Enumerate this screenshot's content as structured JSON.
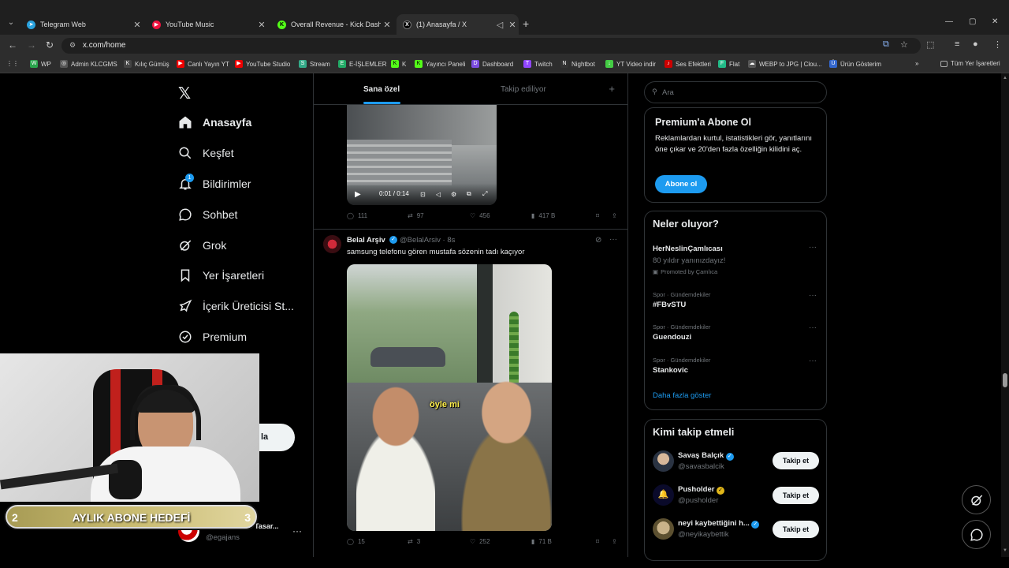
{
  "browser": {
    "tabs": [
      {
        "title": "Telegram Web",
        "color": "#2aa3df"
      },
      {
        "title": "YouTube Music",
        "color": "#f0113d"
      },
      {
        "title": "Overall Revenue - Kick Dashbo",
        "color": "#53fc18"
      },
      {
        "title": "(1) Anasayfa / X",
        "color": "#ffffff"
      }
    ],
    "url": "x.com/home",
    "bookmarks": [
      "WP",
      "Admin KLCGMS",
      "Kılıç Gümüş",
      "Canlı Yayın YT",
      "YouTube Studio",
      "Stream",
      "E-İŞLEMLER",
      "K",
      "Yayıncı Paneli",
      "Dashboard",
      "Twitch",
      "Nightbot",
      "YT Video indir",
      "Ses Efektleri",
      "Flat",
      "WEBP to JPG | Clou...",
      "Ürün Gösterim"
    ],
    "all_bookmarks": "Tüm Yer İşaretleri"
  },
  "sidebar": {
    "items": [
      {
        "label": "Anasayfa",
        "icon": "home-icon"
      },
      {
        "label": "Keşfet",
        "icon": "search-icon"
      },
      {
        "label": "Bildirimler",
        "icon": "bell-icon",
        "badge": "1"
      },
      {
        "label": "Sohbet",
        "icon": "chat-icon"
      },
      {
        "label": "Grok",
        "icon": "grok-icon"
      },
      {
        "label": "Yer İşaretleri",
        "icon": "bookmark-icon"
      },
      {
        "label": "İçerik Üreticisi St...",
        "icon": "rocket-icon"
      },
      {
        "label": "Premium",
        "icon": "verified-icon"
      }
    ],
    "post_button_partial": "la",
    "account": {
      "name": "Eg Ajans Web Tasar...",
      "handle": "@egajans"
    }
  },
  "feed": {
    "tabs": [
      "Sana özel",
      "Takip ediliyor"
    ],
    "post1": {
      "video_time": "0:01 / 0:14",
      "replies": "111",
      "reposts": "97",
      "likes": "456",
      "views": "417 B"
    },
    "post2": {
      "name": "Belal Arşiv",
      "handle": "@BelalArsiv · 8s",
      "text": "samsung telefonu gören mustafa sözenin tadı kaçıyor",
      "subtitle": "öyle mi",
      "replies": "15",
      "reposts": "3",
      "likes": "252",
      "views": "71 B"
    }
  },
  "right": {
    "search_placeholder": "Ara",
    "premium": {
      "title": "Premium'a Abone Ol",
      "text": "Reklamlardan kurtul, istatistikleri gör, yanıtlarını öne çıkar ve 20'den fazla özelliğin kilidini aç.",
      "button": "Abone ol"
    },
    "trends": {
      "title": "Neler oluyor?",
      "promoted": {
        "name": "HerNeslinÇamlıcası",
        "desc": "80 yıldır yanınızdayız!",
        "by": "Promoted by Çamlıca"
      },
      "items": [
        {
          "ctx": "Spor · Gündemdekiler",
          "name": "#FBvSTU"
        },
        {
          "ctx": "Spor · Gündemdekiler",
          "name": "Guendouzi"
        },
        {
          "ctx": "Spor · Gündemdekiler",
          "name": "Stankovic"
        }
      ],
      "more": "Daha fazla göster"
    },
    "who": {
      "title": "Kimi takip etmeli",
      "follow_label": "Takip et",
      "users": [
        {
          "name": "Savaş Balçık",
          "handle": "@savasbalcik"
        },
        {
          "name": "Pusholder",
          "handle": "@pusholder"
        },
        {
          "name": "neyi kaybettiğini h...",
          "handle": "@neyikaybettik"
        }
      ]
    }
  },
  "overlay": {
    "goal_label": "AYLIK ABONE HEDEFİ",
    "goal_current": "2",
    "goal_target": "3"
  },
  "colors": {
    "accent": "#1d9bf0",
    "bg": "#000000",
    "border": "#2f3336"
  }
}
